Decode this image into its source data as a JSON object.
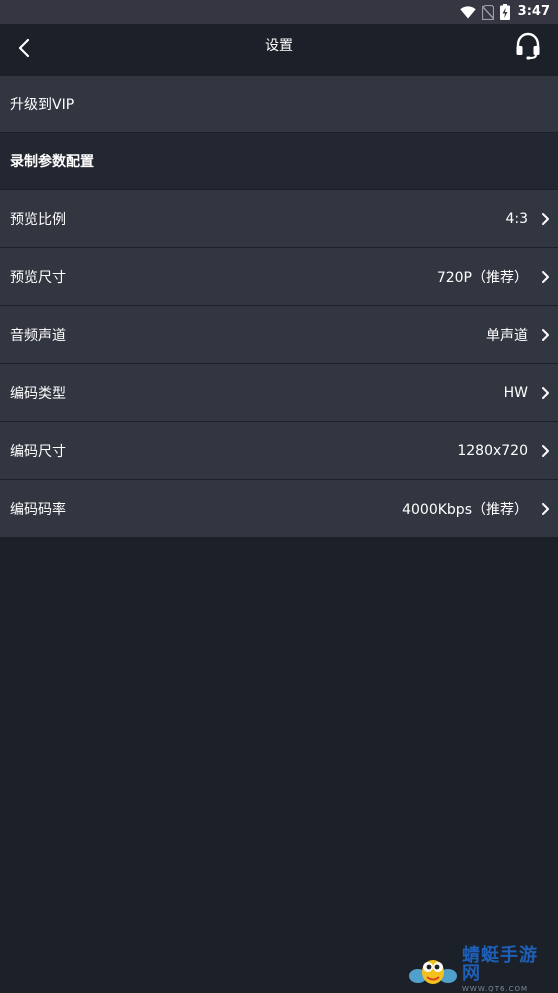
{
  "status_bar": {
    "time": "3:47",
    "icons": [
      "wifi-icon",
      "no-sim-icon",
      "battery-charging-icon"
    ]
  },
  "header": {
    "title": "设置",
    "back_icon": "chevron-left-icon",
    "support_icon": "headset-icon"
  },
  "menu": {
    "upgrade_label": "升级到VIP",
    "section_title": "录制参数配置",
    "items": [
      {
        "label": "预览比例",
        "value": "4:3"
      },
      {
        "label": "预览尺寸",
        "value": "720P（推荐）"
      },
      {
        "label": "音频声道",
        "value": "单声道"
      },
      {
        "label": "编码类型",
        "value": "HW"
      },
      {
        "label": "编码尺寸",
        "value": "1280x720"
      },
      {
        "label": "编码码率",
        "value": "4000Kbps（推荐）"
      }
    ]
  },
  "watermark": {
    "title": "蜻蜓手游网",
    "subtitle": "WWW.QT6.COM"
  },
  "colors": {
    "background": "#1c2029",
    "status_bar": "#353641",
    "row": "#323641",
    "section": "#232731",
    "text": "#ffffff"
  }
}
